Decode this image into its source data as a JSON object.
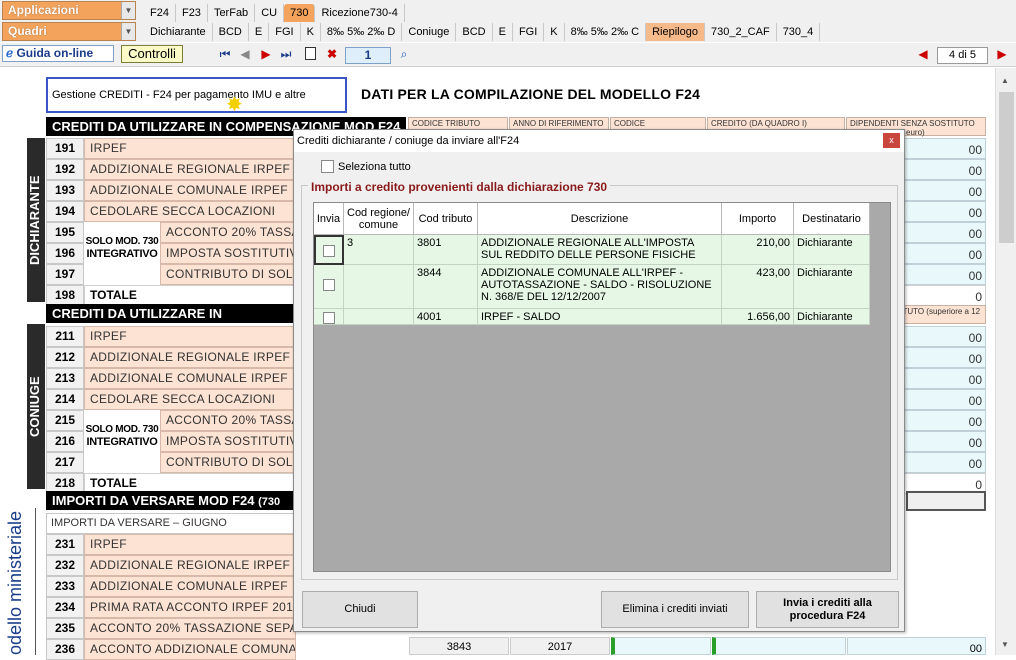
{
  "menus": {
    "applicazioni": "Applicazioni",
    "quadri": "Quadri"
  },
  "row1_tabs": [
    "F24",
    "F23",
    "TerFab",
    "CU",
    "730",
    "Ricezione730-4"
  ],
  "row2_tabs": [
    "Dichiarante",
    "BCD",
    "E",
    "FGI",
    "K",
    "8‰ 5‰ 2‰ D",
    "Coniuge",
    "BCD",
    "E",
    "FGI",
    "K",
    "8‰ 5‰ 2‰ C",
    "Riepilogo",
    "730_2_CAF",
    "730_4"
  ],
  "toolbar": {
    "guida": "Guida on-line",
    "controlli": "Controlli",
    "page_input": "1",
    "pager": "4 di 5"
  },
  "form": {
    "gestione_button": "Gestione CREDITI -  F24 per pagamento IMU e altre imposte",
    "title": "DATI PER LA COMPILAZIONE DEL MODELLO F24",
    "section1": "CREDITI DA UTILIZZARE IN COMPENSAZIONE MOD F24",
    "section2": "CREDITI DA UTILIZZARE IN COMPENSAZIONE",
    "section3": "IMPORTI DA VERSARE MOD F24",
    "section3_suffix": "(730",
    "dichiarante_label": "DICHIARANTE",
    "coniuge_label": "CONIUGE",
    "side_label": "odello ministeriale",
    "col_headers": [
      "CODICE TRIBUTO",
      "ANNO DI RIFERIMENTO",
      "CODICE",
      "CREDITO (DA QUADRO I)"
    ],
    "col_right_header": "DIPENDENTI SENZA SOSTITUTO (superiore a 12 euro)",
    "col_right_header2": "SENZA SOSTITUTO (superiore a 12 euro)",
    "solo_mod": "SOLO MOD. 730",
    "integrativo": "INTEGRATIVO",
    "rows_dich": [
      {
        "n": "191",
        "t": "IRPEF"
      },
      {
        "n": "192",
        "t": "ADDIZIONALE REGIONALE IRPEF"
      },
      {
        "n": "193",
        "t": "ADDIZIONALE COMUNALE IRPEF"
      },
      {
        "n": "194",
        "t": "CEDOLARE SECCA LOCAZIONI"
      },
      {
        "n": "195",
        "t": "ACCONTO 20% TASSA"
      },
      {
        "n": "196",
        "t": "IMPOSTA SOSTITUTIVA I"
      },
      {
        "n": "197",
        "t": "CONTRIBUTO DI SOLIDA"
      },
      {
        "n": "198",
        "t": "TOTALE"
      }
    ],
    "rows_con": [
      {
        "n": "211",
        "t": "IRPEF"
      },
      {
        "n": "212",
        "t": "ADDIZIONALE REGIONALE IRPEF"
      },
      {
        "n": "213",
        "t": "ADDIZIONALE COMUNALE IRPEF"
      },
      {
        "n": "214",
        "t": "CEDOLARE SECCA LOCAZIONI"
      },
      {
        "n": "215",
        "t": "ACCONTO 20% TASSA"
      },
      {
        "n": "216",
        "t": "IMPOSTA SOSTITUTIVA I"
      },
      {
        "n": "217",
        "t": "CONTRIBUTO DI SOLIDA"
      },
      {
        "n": "218",
        "t": "TOTALE"
      }
    ],
    "importi_giugno": "IMPORTI DA VERSARE – GIUGNO",
    "rows_vers": [
      {
        "n": "231",
        "t": "IRPEF"
      },
      {
        "n": "232",
        "t": "ADDIZIONALE REGIONALE IRPEF"
      },
      {
        "n": "233",
        "t": "ADDIZIONALE COMUNALE IRPEF"
      },
      {
        "n": "234",
        "t": "PRIMA RATA ACCONTO IRPEF 2017"
      },
      {
        "n": "235",
        "t": "ACCONTO 20% TASSAZIONE SEPAR"
      },
      {
        "n": "236",
        "t": "ACCONTO ADDIZIONALE COMUNALE 2017"
      }
    ],
    "cell_value": "00",
    "total_value": "0",
    "row236_code": "3843",
    "row236_year": "2017"
  },
  "dialog": {
    "title": "Crediti dichiarante / coniuge da inviare all'F24",
    "close": "x",
    "select_all": "Seleziona tutto",
    "group_title": "Importi a credito provenienti dalla dichiarazione 730",
    "columns": [
      "Invia",
      "Cod regione/ comune",
      "Cod tributo",
      "Descrizione",
      "Importo",
      "Destinatario"
    ],
    "rows": [
      {
        "reg": "3",
        "trib": "3801",
        "desc": "ADDIZIONALE REGIONALE ALL'IMPOSTA SUL REDDITO DELLE PERSONE FISICHE",
        "imp": "210,00",
        "dest": "Dichiarante"
      },
      {
        "reg": "",
        "trib": "3844",
        "desc": "ADDIZIONALE COMUNALE ALL'IRPEF - AUTOTASSAZIONE - SALDO - RISOLUZIONE N. 368/E DEL 12/12/2007",
        "imp": "423,00",
        "dest": "Dichiarante"
      },
      {
        "reg": "",
        "trib": "4001",
        "desc": "IRPEF - SALDO",
        "imp": "1.656,00",
        "dest": "Dichiarante"
      }
    ],
    "btn_chiudi": "Chiudi",
    "btn_elimina": "Elimina i crediti inviati",
    "btn_invia": "Invia i crediti alla procedura F24"
  },
  "colors": {
    "accent": "#f3a35c",
    "row_text_bg": "#fce3d3",
    "cell_bg": "#e9f8fb",
    "grid_row_bg": "#e6f7e6",
    "group_title": "#8a1a1a"
  }
}
